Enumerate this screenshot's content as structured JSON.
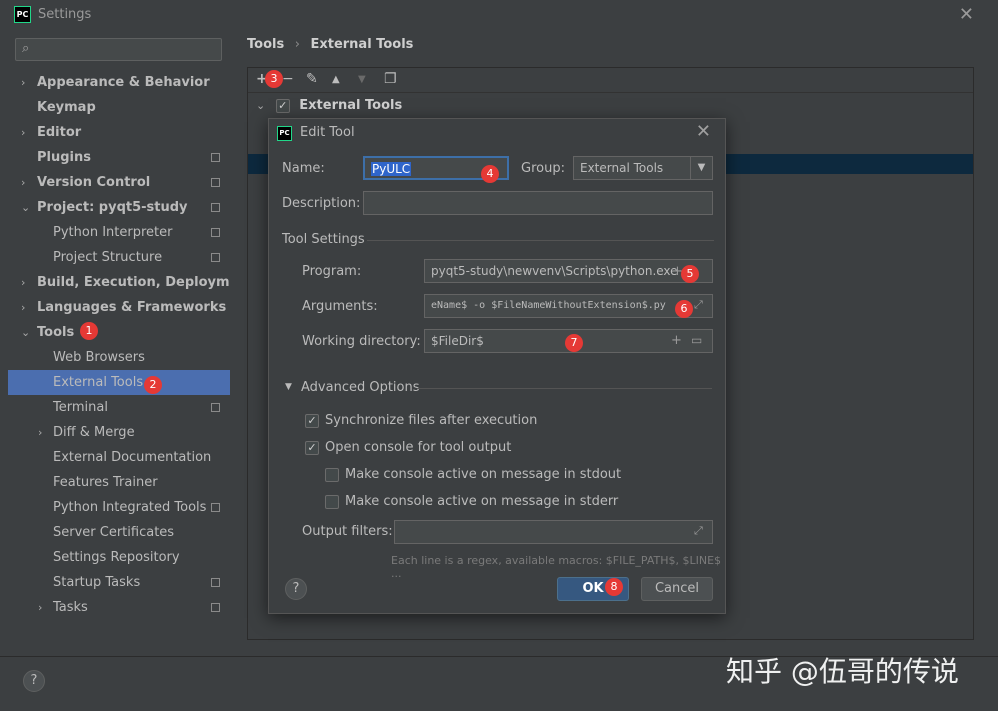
{
  "window": {
    "title": "Settings",
    "app_icon_text": "PC"
  },
  "sidebar": {
    "items": [
      {
        "label": "Appearance & Behavior"
      },
      {
        "label": "Keymap"
      },
      {
        "label": "Editor"
      },
      {
        "label": "Plugins"
      },
      {
        "label": "Version Control"
      },
      {
        "label": "Project: pyqt5-study"
      },
      {
        "label": "Python Interpreter"
      },
      {
        "label": "Project Structure"
      },
      {
        "label": "Build, Execution, Deployment"
      },
      {
        "label": "Languages & Frameworks"
      },
      {
        "label": "Tools"
      },
      {
        "label": "Web Browsers"
      },
      {
        "label": "External Tools"
      },
      {
        "label": "Terminal"
      },
      {
        "label": "Diff & Merge"
      },
      {
        "label": "External Documentation"
      },
      {
        "label": "Features Trainer"
      },
      {
        "label": "Python Integrated Tools"
      },
      {
        "label": "Server Certificates"
      },
      {
        "label": "Settings Repository"
      },
      {
        "label": "Startup Tasks"
      },
      {
        "label": "Tasks"
      }
    ]
  },
  "content": {
    "breadcrumb": [
      "Tools",
      "External Tools"
    ],
    "toolbar": {
      "add": "+",
      "remove": "−",
      "edit": "✎",
      "up": "▲",
      "down": "▼",
      "copy": "❐"
    },
    "group_label": "External Tools"
  },
  "dialog": {
    "title": "Edit Tool",
    "name_label": "Name:",
    "name_value": "PyULC",
    "group_label": "Group:",
    "group_value": "External Tools",
    "description_label": "Description:",
    "description_value": "",
    "tool_settings_label": "Tool Settings",
    "program_label": "Program:",
    "program_value": "pyqt5-study\\newvenv\\Scripts\\python.exe",
    "arguments_label": "Arguments:",
    "arguments_value": "eName$ -o $FileNameWithoutExtension$.py",
    "workdir_label": "Working directory:",
    "workdir_value": "$FileDir$",
    "advanced_label": "Advanced Options",
    "sync_label": "Synchronize files after execution",
    "console_label": "Open console for tool output",
    "stdout_label": "Make console active on message in stdout",
    "stderr_label": "Make console active on message in stderr",
    "output_filters_label": "Output filters:",
    "hint": "Each line is a regex, available macros: $FILE_PATH$, $LINE$ ...",
    "ok_label": "OK",
    "cancel_label": "Cancel",
    "help_label": "?"
  },
  "badges": [
    "1",
    "2",
    "3",
    "4",
    "5",
    "6",
    "7",
    "8"
  ],
  "footer": {
    "help_label": "?"
  },
  "watermark": "知乎 @伍哥的传说",
  "colors": {
    "selection": "#4b6eaf",
    "badge": "#e53935",
    "ok_button": "#365880"
  }
}
